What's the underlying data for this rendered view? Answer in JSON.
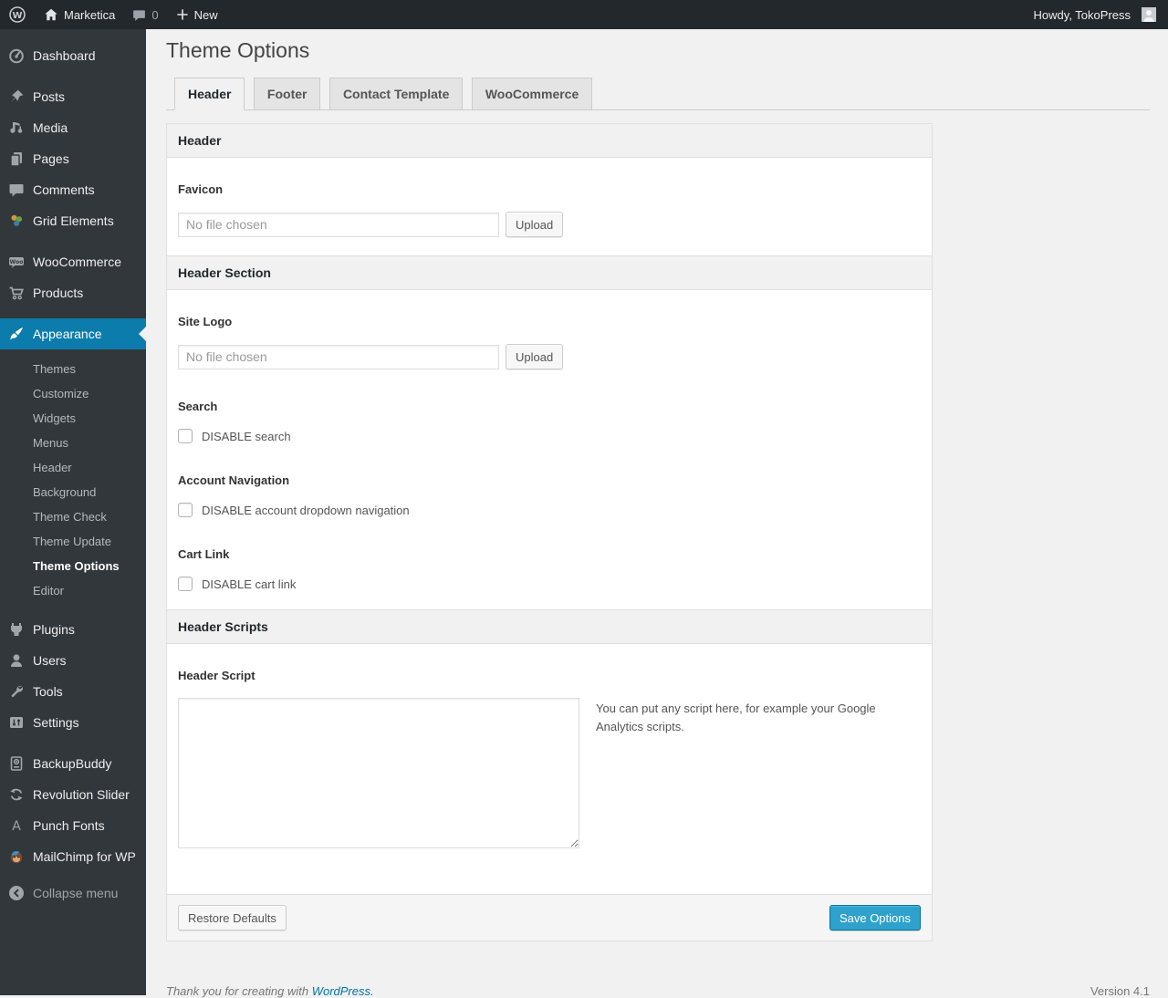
{
  "admin_bar": {
    "site_name": "Marketica",
    "comment_count": "0",
    "new_label": "New",
    "howdy_text": "Howdy, TokoPress"
  },
  "sidebar": {
    "items": {
      "dashboard": "Dashboard",
      "posts": "Posts",
      "media": "Media",
      "pages": "Pages",
      "comments": "Comments",
      "grid_elements": "Grid Elements",
      "woocommerce": "WooCommerce",
      "products": "Products",
      "appearance": "Appearance",
      "plugins": "Plugins",
      "users": "Users",
      "tools": "Tools",
      "settings": "Settings",
      "backupbuddy": "BackupBuddy",
      "revolution_slider": "Revolution Slider",
      "punch_fonts": "Punch Fonts",
      "mailchimp": "MailChimp for WP",
      "collapse": "Collapse menu"
    },
    "appearance_submenu": {
      "themes": "Themes",
      "customize": "Customize",
      "widgets": "Widgets",
      "menus": "Menus",
      "header": "Header",
      "background": "Background",
      "theme_check": "Theme Check",
      "theme_update": "Theme Update",
      "theme_options": "Theme Options",
      "editor": "Editor"
    }
  },
  "main": {
    "page_title": "Theme Options",
    "tabs": {
      "header": "Header",
      "footer": "Footer",
      "contact_template": "Contact Template",
      "woocommerce": "WooCommerce"
    },
    "panel": {
      "section_header_title": "Header",
      "favicon_label": "Favicon",
      "favicon_placeholder": "No file chosen",
      "favicon_upload_label": "Upload",
      "section_header_section_title": "Header Section",
      "site_logo_label": "Site Logo",
      "site_logo_placeholder": "No file chosen",
      "site_logo_upload_label": "Upload",
      "search_label": "Search",
      "search_checkbox_label": "DISABLE search",
      "account_nav_label": "Account Navigation",
      "account_nav_checkbox_label": "DISABLE account dropdown navigation",
      "cart_link_label": "Cart Link",
      "cart_link_checkbox_label": "DISABLE cart link",
      "section_header_scripts_title": "Header Scripts",
      "header_script_label": "Header Script",
      "header_script_value": "",
      "header_script_description": "You can put any script here, for example your Google Analytics scripts.",
      "restore_defaults_label": "Restore Defaults",
      "save_options_label": "Save Options"
    },
    "page_footer": {
      "thanks_text": "Thank you for creating with",
      "thanks_link": "WordPress.",
      "version": "Version 4.1"
    }
  },
  "colors": {
    "admin_bar_bg": "#23282d",
    "sidebar_bg": "#32373c",
    "menu_highlight": "#0c7cac",
    "primary_button_bg": "#2ea2cc",
    "primary_button_border": "#0074a2",
    "link_blue": "#0074a2"
  }
}
